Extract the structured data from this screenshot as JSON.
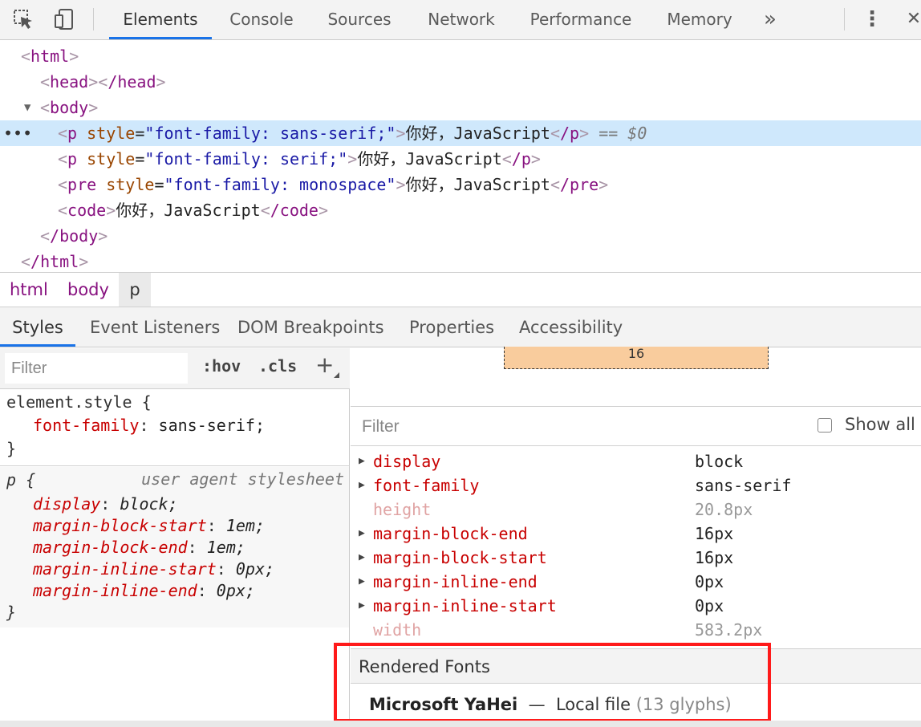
{
  "toolbar": {
    "tabs": [
      "Elements",
      "Console",
      "Sources",
      "Network",
      "Performance",
      "Memory"
    ],
    "more_tabs_glyph": "»",
    "menu_glyph": "⋮",
    "close_glyph": "✕"
  },
  "dom_tree": {
    "html_open": "html",
    "head_open": "head",
    "head_close": "/head",
    "body_open": "body",
    "p1": {
      "tag": "p",
      "attr": "style",
      "value": "\"font-family: sans-serif;\"",
      "text": "你好，JavaScript",
      "close": "/p",
      "marker": "== $0"
    },
    "p2": {
      "tag": "p",
      "attr": "style",
      "value": "\"font-family: serif;\"",
      "text": "你好，JavaScript",
      "close": "/p"
    },
    "pre": {
      "tag": "pre",
      "attr": "style",
      "value": "\"font-family: monospace\"",
      "text": "你好，JavaScript",
      "close": "/pre"
    },
    "code": {
      "tag": "code",
      "text": "你好，JavaScript",
      "close": "/code"
    },
    "body_close": "/body",
    "html_close": "/html",
    "ellipsis": "•••"
  },
  "breadcrumb": [
    "html",
    "body",
    "p"
  ],
  "subtabs": [
    "Styles",
    "Event Listeners",
    "DOM Breakpoints",
    "Properties",
    "Accessibility"
  ],
  "styles": {
    "filter_placeholder": "Filter",
    "hov": ":hov",
    "cls": ".cls",
    "add": "+",
    "element_style": {
      "selector": "element.style {",
      "prop": "font-family",
      "value": "sans-serif;",
      "close": "}"
    },
    "ua_rule": {
      "selector": "p {",
      "source": "user agent stylesheet",
      "decls": [
        {
          "prop": "display",
          "value": "block;"
        },
        {
          "prop": "margin-block-start",
          "value": "1em;"
        },
        {
          "prop": "margin-block-end",
          "value": "1em;"
        },
        {
          "prop": "margin-inline-start",
          "value": "0px;"
        },
        {
          "prop": "margin-inline-end",
          "value": "0px;"
        }
      ],
      "close": "}"
    }
  },
  "computed": {
    "box_model_value": "16",
    "filter_placeholder": "Filter",
    "show_all_label": "Show all",
    "show_all_checked": false,
    "properties": [
      {
        "name": "display",
        "value": "block",
        "expandable": true,
        "inherited": false
      },
      {
        "name": "font-family",
        "value": "sans-serif",
        "expandable": true,
        "inherited": false
      },
      {
        "name": "height",
        "value": "20.8px",
        "expandable": false,
        "inherited": true
      },
      {
        "name": "margin-block-end",
        "value": "16px",
        "expandable": true,
        "inherited": false
      },
      {
        "name": "margin-block-start",
        "value": "16px",
        "expandable": true,
        "inherited": false
      },
      {
        "name": "margin-inline-end",
        "value": "0px",
        "expandable": true,
        "inherited": false
      },
      {
        "name": "margin-inline-start",
        "value": "0px",
        "expandable": true,
        "inherited": false
      },
      {
        "name": "width",
        "value": "583.2px",
        "expandable": false,
        "inherited": true
      }
    ],
    "rendered_fonts": {
      "header": "Rendered Fonts",
      "font_name": "Microsoft YaHei",
      "dash": "—",
      "source": "Local file",
      "glyphs": "(13 glyphs)"
    }
  },
  "colors": {
    "accent": "#1a73e8",
    "highlight": "#ff1a1a",
    "selected_row": "#cfe8fc",
    "tag": "#881280",
    "attr_name": "#994500",
    "attr_value": "#1a1aa6",
    "css_prop": "#c80000",
    "box_model_fill": "#f9cc9d"
  }
}
